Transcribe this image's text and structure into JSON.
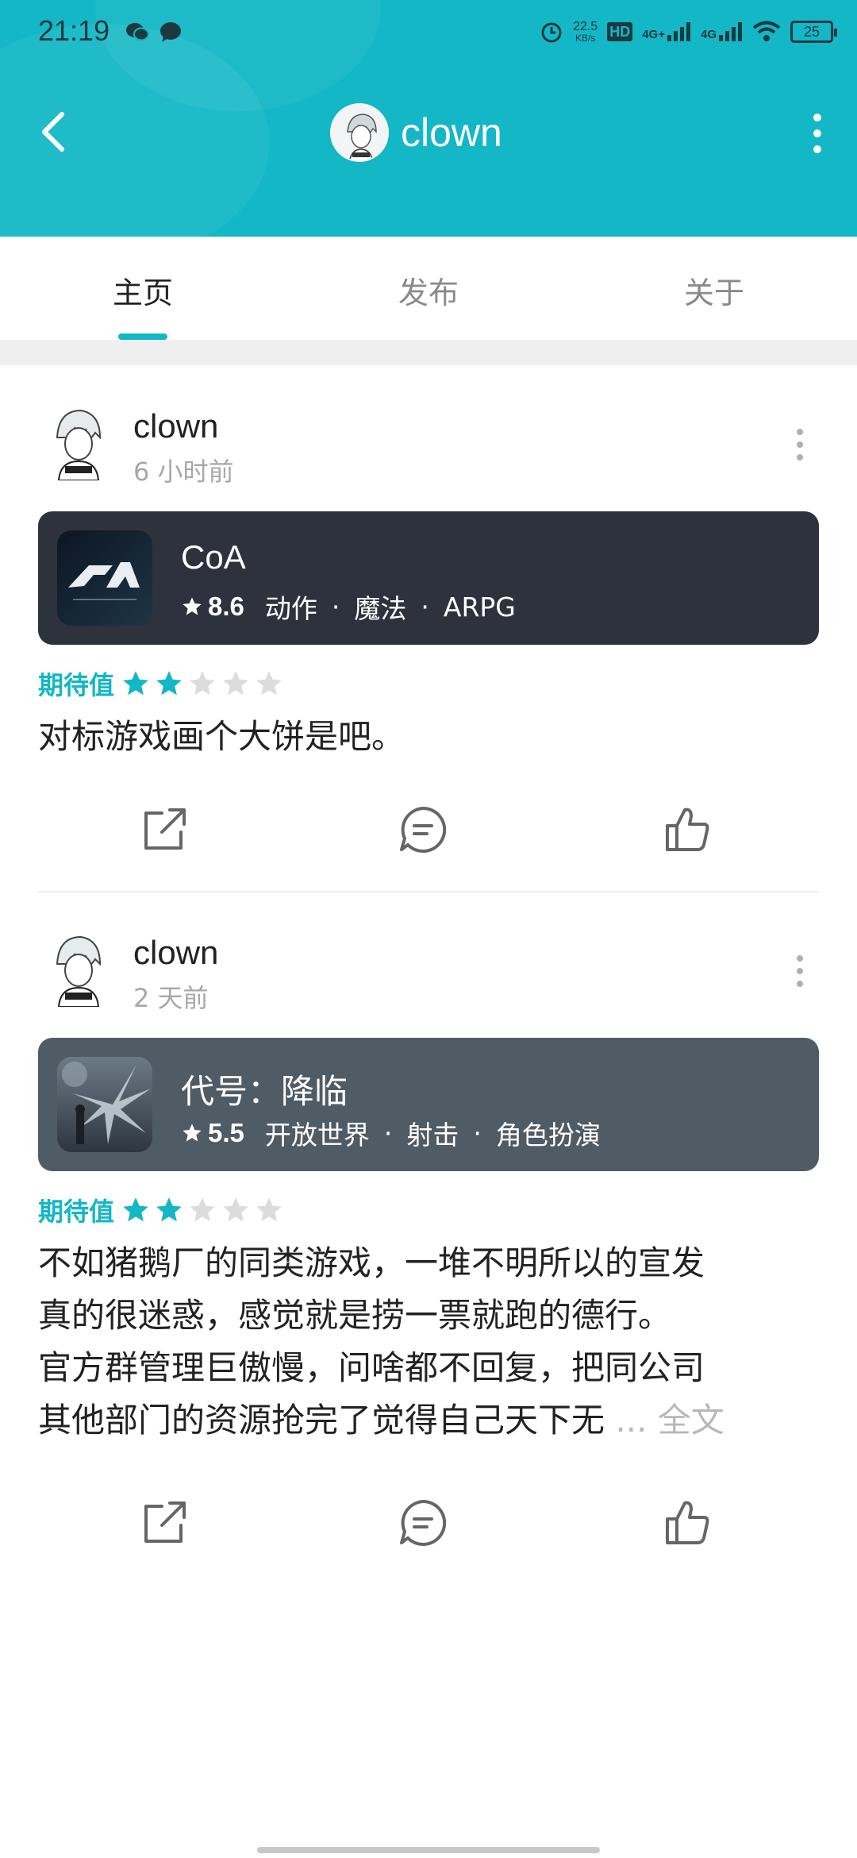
{
  "status_bar": {
    "time": "21:19",
    "speed_value": "22.5",
    "speed_unit": "KB/s",
    "hd_label": "HD",
    "net1": "4G+",
    "net2": "4G",
    "battery": "25"
  },
  "nav": {
    "title": "clown",
    "back_icon": "chevron-left-icon",
    "more_icon": "more-vertical-icon"
  },
  "tabs": [
    {
      "label": "主页",
      "active": true
    },
    {
      "label": "发布",
      "active": false
    },
    {
      "label": "关于",
      "active": false
    }
  ],
  "colors": {
    "accent": "#13b7c6",
    "card1_bg": "#2d323d",
    "card2_bg": "#4f5b65",
    "star_inactive": "#dcdcdc"
  },
  "posts": [
    {
      "author": "clown",
      "time": "6 小时前",
      "game": {
        "title": "CoA",
        "rating": "8.6",
        "tags": [
          "动作",
          "魔法",
          "ARPG"
        ]
      },
      "expect_label": "期待值",
      "expect_stars": 2,
      "expect_max": 5,
      "content_lines": [
        "对标游戏画个大饼是吧。"
      ]
    },
    {
      "author": "clown",
      "time": "2 天前",
      "game": {
        "title": "代号：降临",
        "rating": "5.5",
        "tags": [
          "开放世界",
          "射击",
          "角色扮演"
        ]
      },
      "expect_label": "期待值",
      "expect_stars": 2,
      "expect_max": 5,
      "content_lines": [
        "不如猪鹅厂的同类游戏，一堆不明所以的宣发",
        "真的很迷惑，感觉就是捞一票就跑的德行。",
        "官方群管理巨傲慢，问啥都不回复，把同公司",
        "其他部门的资源抢完了觉得自己天下无"
      ],
      "ellipsis": "...",
      "full_text_label": "全文"
    }
  ],
  "actions": {
    "share_icon": "share-icon",
    "comment_icon": "comment-icon",
    "like_icon": "thumbs-up-icon"
  }
}
